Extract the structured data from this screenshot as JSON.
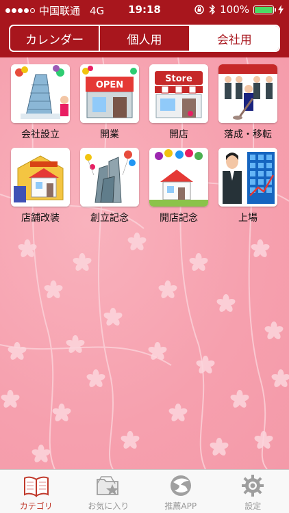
{
  "status": {
    "carrier": "中国联通",
    "network": "4G",
    "time": "19:18",
    "battery": "100%",
    "battery_level": 1.0
  },
  "segments": [
    {
      "label": "カレンダー",
      "active": false
    },
    {
      "label": "個人用",
      "active": false
    },
    {
      "label": "会社用",
      "active": true
    }
  ],
  "categories": [
    {
      "label": "会社設立",
      "icon": "building-balloons-icon"
    },
    {
      "label": "開業",
      "icon": "open-shop-icon"
    },
    {
      "label": "開店",
      "icon": "store-icon"
    },
    {
      "label": "落成・移転",
      "icon": "ceremony-icon"
    },
    {
      "label": "店舗改装",
      "icon": "house-renovation-icon"
    },
    {
      "label": "創立記念",
      "icon": "towers-balloons-icon"
    },
    {
      "label": "開店記念",
      "icon": "house-balloons-icon"
    },
    {
      "label": "上場",
      "icon": "stock-chart-icon"
    }
  ],
  "tabs": [
    {
      "label": "カテゴリ",
      "icon": "book-icon",
      "active": true
    },
    {
      "label": "お気に入り",
      "icon": "folder-star-icon",
      "active": false
    },
    {
      "label": "推薦APP",
      "icon": "bird-logo-icon",
      "active": false
    },
    {
      "label": "設定",
      "icon": "gear-icon",
      "active": false
    }
  ],
  "colors": {
    "header": "#a8161d",
    "background": "#f6a0ae",
    "tab_active": "#c0392b"
  }
}
